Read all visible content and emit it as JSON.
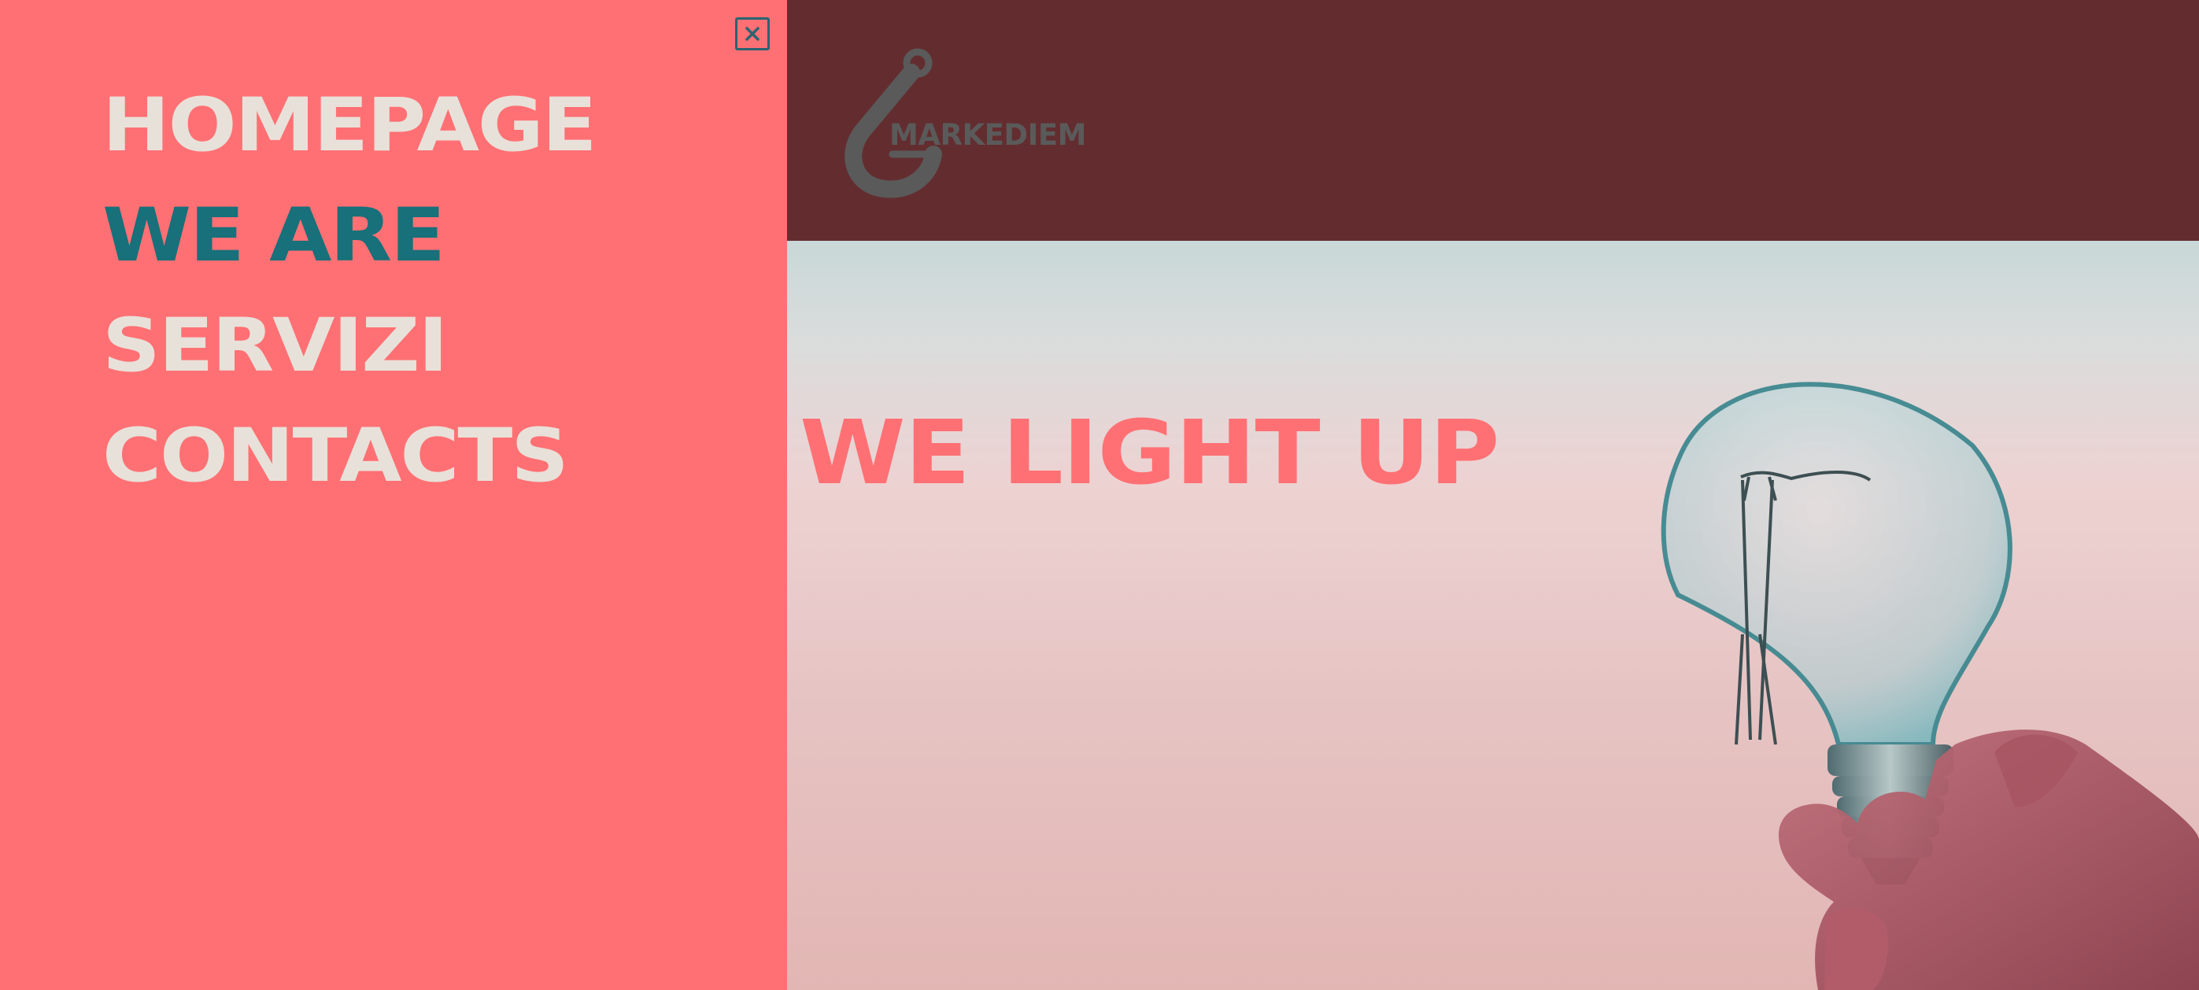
{
  "menu": {
    "close_icon": "close-icon",
    "items": [
      {
        "label": "HOMEPAGE",
        "active": false
      },
      {
        "label": "WE ARE",
        "active": true
      },
      {
        "label": "SERVIZI",
        "active": false
      },
      {
        "label": "CONTACTS",
        "active": false
      }
    ]
  },
  "header": {
    "logo_icon": "hook-icon",
    "logo_text": "MARKEDIEM"
  },
  "hero": {
    "title": "WE LIGHT UP",
    "image": "hand-holding-light-bulb"
  },
  "colors": {
    "menu_bg": "#ff7074",
    "menu_text": "#e8e1d9",
    "menu_active": "#17707a",
    "header_bg": "#632d30",
    "logo": "#5a5a5a",
    "hero_title": "#ff7074"
  }
}
